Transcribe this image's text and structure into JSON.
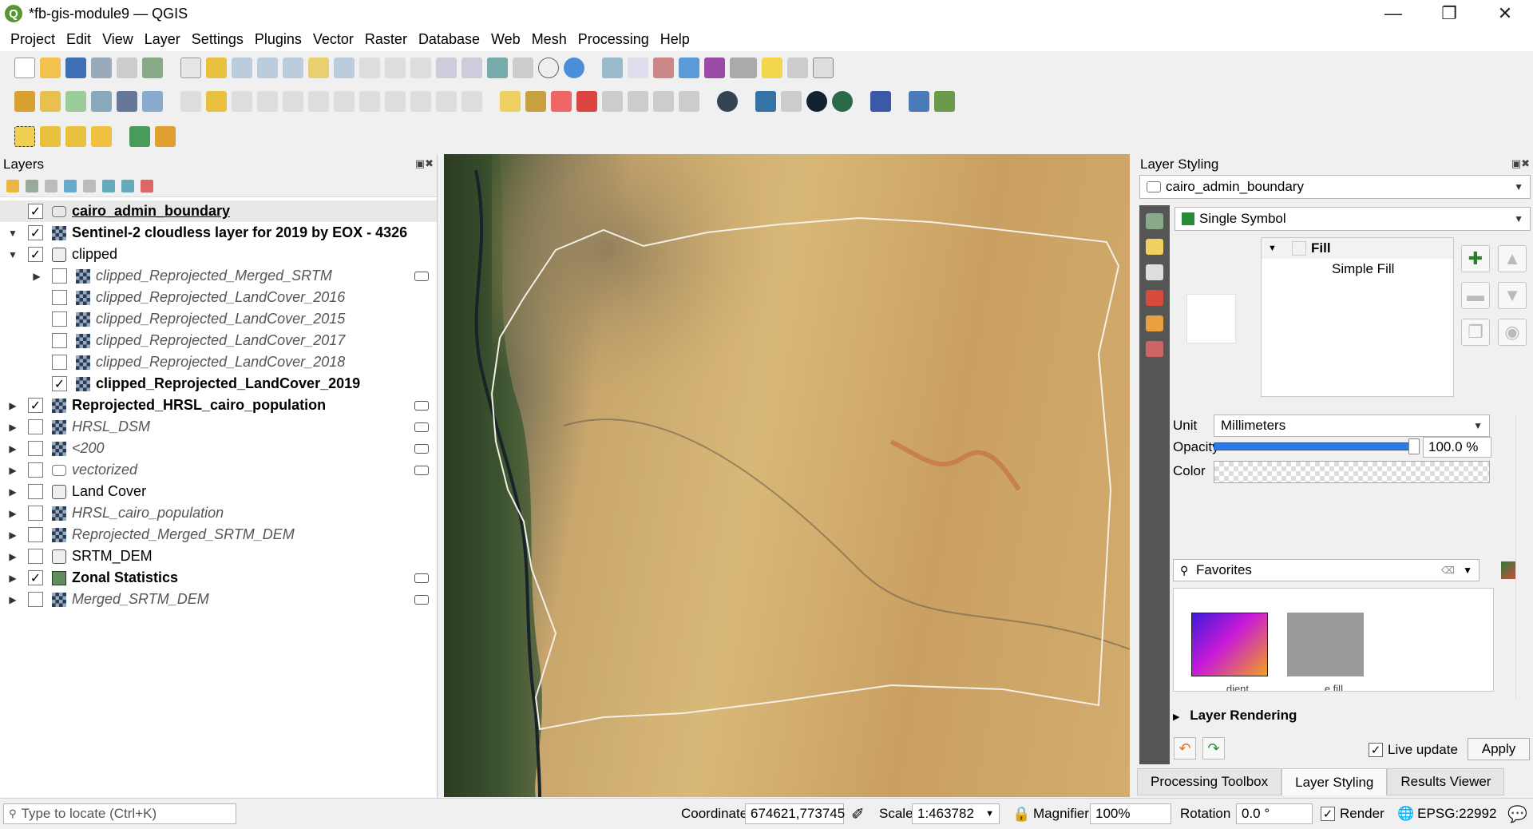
{
  "window": {
    "title": "*fb-gis-module9 — QGIS",
    "app_icon": "Q"
  },
  "menu": [
    "Project",
    "Edit",
    "View",
    "Layer",
    "Settings",
    "Plugins",
    "Vector",
    "Raster",
    "Database",
    "Web",
    "Mesh",
    "Processing",
    "Help"
  ],
  "layers_panel": {
    "title": "Layers",
    "layers": [
      {
        "name": "cairo_admin_boundary",
        "checked": true,
        "bold": true,
        "italic": false,
        "underline": true,
        "indent": 0,
        "expander": "",
        "icon": "vector-polygon-icon",
        "indicator": false,
        "selected": true
      },
      {
        "name": "Sentinel-2 cloudless layer for 2019 by EOX - 4326",
        "checked": true,
        "bold": true,
        "italic": false,
        "indent": 0,
        "expander": "▼",
        "icon": "raster-icon",
        "indicator": false
      },
      {
        "name": "clipped",
        "checked": true,
        "bold": false,
        "italic": false,
        "indent": 0,
        "expander": "▼",
        "icon": "group-icon",
        "indicator": false
      },
      {
        "name": "clipped_Reprojected_Merged_SRTM",
        "checked": false,
        "bold": false,
        "italic": true,
        "indent": 1,
        "expander": "▶",
        "icon": "raster-icon",
        "indicator": true
      },
      {
        "name": "clipped_Reprojected_LandCover_2016",
        "checked": false,
        "bold": false,
        "italic": true,
        "indent": 1,
        "expander": "",
        "icon": "raster-icon",
        "indicator": false
      },
      {
        "name": "clipped_Reprojected_LandCover_2015",
        "checked": false,
        "bold": false,
        "italic": true,
        "indent": 1,
        "expander": "",
        "icon": "raster-icon",
        "indicator": false
      },
      {
        "name": "clipped_Reprojected_LandCover_2017",
        "checked": false,
        "bold": false,
        "italic": true,
        "indent": 1,
        "expander": "",
        "icon": "raster-icon",
        "indicator": false
      },
      {
        "name": "clipped_Reprojected_LandCover_2018",
        "checked": false,
        "bold": false,
        "italic": true,
        "indent": 1,
        "expander": "",
        "icon": "raster-icon",
        "indicator": false
      },
      {
        "name": "clipped_Reprojected_LandCover_2019",
        "checked": true,
        "bold": true,
        "italic": false,
        "indent": 1,
        "expander": "",
        "icon": "raster-icon",
        "indicator": false
      },
      {
        "name": "Reprojected_HRSL_cairo_population",
        "checked": true,
        "bold": true,
        "italic": false,
        "indent": 0,
        "expander": "▶",
        "icon": "raster-icon",
        "indicator": true
      },
      {
        "name": "HRSL_DSM",
        "checked": false,
        "bold": false,
        "italic": true,
        "indent": 0,
        "expander": "▶",
        "icon": "raster-icon",
        "indicator": true
      },
      {
        "name": "<200",
        "checked": false,
        "bold": false,
        "italic": true,
        "indent": 0,
        "expander": "▶",
        "icon": "raster-icon",
        "indicator": true
      },
      {
        "name": "vectorized",
        "checked": false,
        "bold": false,
        "italic": true,
        "indent": 0,
        "expander": "▶",
        "icon": "vector-polygon-icon",
        "indicator": true
      },
      {
        "name": "Land Cover",
        "checked": false,
        "bold": false,
        "italic": false,
        "indent": 0,
        "expander": "▶",
        "icon": "group-icon",
        "indicator": false
      },
      {
        "name": "HRSL_cairo_population",
        "checked": false,
        "bold": false,
        "italic": true,
        "indent": 0,
        "expander": "▶",
        "icon": "raster-icon",
        "indicator": false
      },
      {
        "name": "Reprojected_Merged_SRTM_DEM",
        "checked": false,
        "bold": false,
        "italic": true,
        "indent": 0,
        "expander": "▶",
        "icon": "raster-icon",
        "indicator": false
      },
      {
        "name": "SRTM_DEM",
        "checked": false,
        "bold": false,
        "italic": false,
        "indent": 0,
        "expander": "▶",
        "icon": "group-icon",
        "indicator": false
      },
      {
        "name": "Zonal Statistics",
        "checked": true,
        "bold": true,
        "italic": false,
        "indent": 0,
        "expander": "▶",
        "icon": "fill-swatch-icon",
        "indicator": true
      },
      {
        "name": "Merged_SRTM_DEM",
        "checked": false,
        "bold": false,
        "italic": true,
        "indent": 0,
        "expander": "▶",
        "icon": "raster-icon",
        "indicator": true
      }
    ]
  },
  "styling_panel": {
    "title": "Layer Styling",
    "layer_combo": "cairo_admin_boundary",
    "renderer_combo": "Single Symbol",
    "symbol_tree": {
      "root": "Fill",
      "child": "Simple Fill"
    },
    "unit_label": "Unit",
    "unit_value": "Millimeters",
    "opacity_label": "Opacity",
    "opacity_value": "100.0 %",
    "opacity_fraction": 1.0,
    "color_label": "Color",
    "favorites_placeholder": "Favorites",
    "symbols": [
      {
        "caption": "...dient",
        "type": "gradient"
      },
      {
        "caption": "...e fill",
        "type": "gray"
      }
    ],
    "layer_rendering": "Layer Rendering",
    "live_update_label": "Live update",
    "live_update_checked": true,
    "apply_label": "Apply"
  },
  "bottom_tabs": [
    "Processing Toolbox",
    "Layer Styling",
    "Results Viewer"
  ],
  "active_bottom_tab": "Layer Styling",
  "statusbar": {
    "locate_placeholder": "Type to locate (Ctrl+K)",
    "coordinate_label": "Coordinate",
    "coordinate_value": "674621,773745",
    "scale_label": "Scale",
    "scale_value": "1:463782",
    "magnifier_label": "Magnifier",
    "magnifier_value": "100%",
    "rotation_label": "Rotation",
    "rotation_value": "0.0 °",
    "render_label": "Render",
    "render_checked": true,
    "crs": "EPSG:22992"
  },
  "colors": {
    "accent_blue": "#2c7be5",
    "qgis_green": "#589632",
    "sidebar_dark": "#555555"
  }
}
